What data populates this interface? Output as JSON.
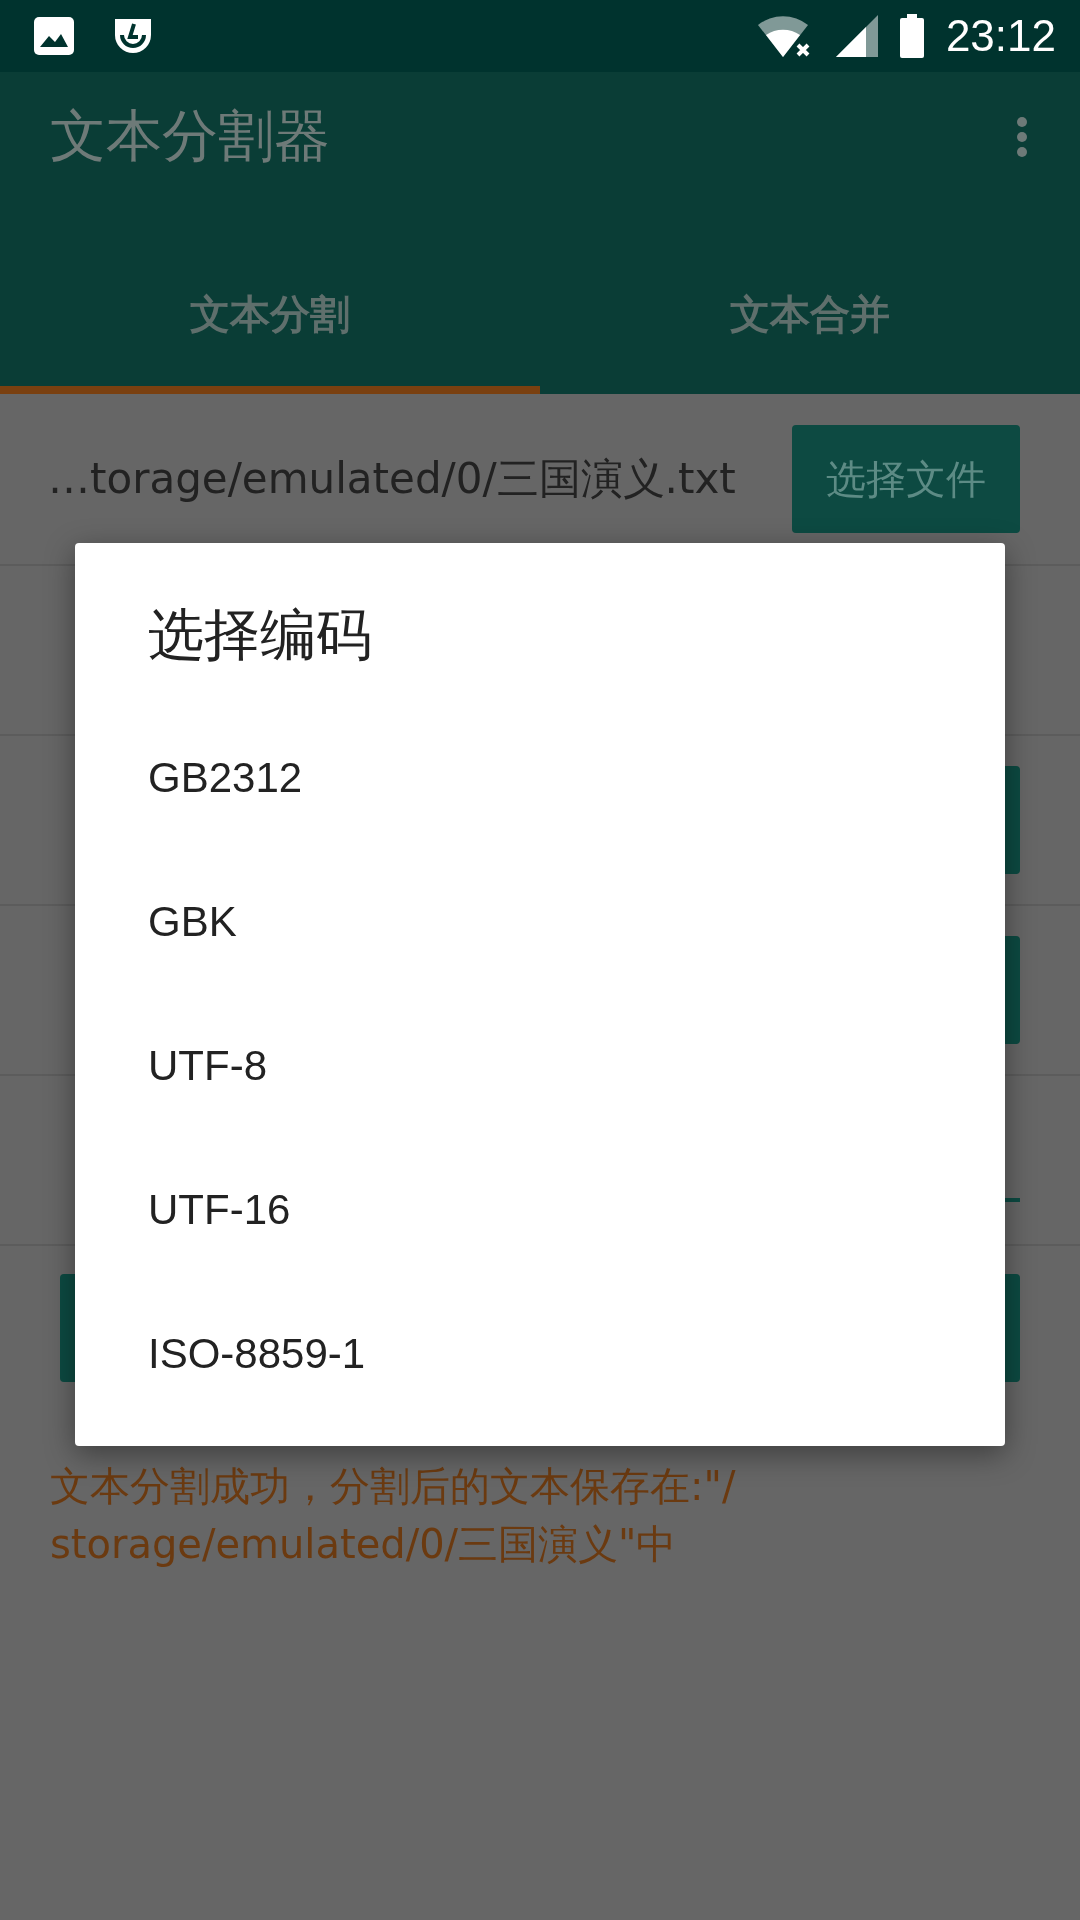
{
  "status_bar": {
    "time": "23:12"
  },
  "app_bar": {
    "title": "文本分割器"
  },
  "tabs": [
    {
      "label": "文本分割",
      "selected": true
    },
    {
      "label": "文本合并",
      "selected": false
    }
  ],
  "file_row": {
    "path": "…torage/emulated/0/三国演义.txt",
    "button": "选择文件"
  },
  "rows": [
    {
      "kind": "plain"
    },
    {
      "kind": "button"
    },
    {
      "kind": "button"
    },
    {
      "kind": "field"
    }
  ],
  "message": "文本分割成功，分割后的文本保存在:\"/\nstorage/emulated/0/三国演义\"中",
  "dialog": {
    "title": "选择编码",
    "options": [
      "GB2312",
      "GBK",
      "UTF-8",
      "UTF-16",
      "ISO-8859-1"
    ]
  }
}
